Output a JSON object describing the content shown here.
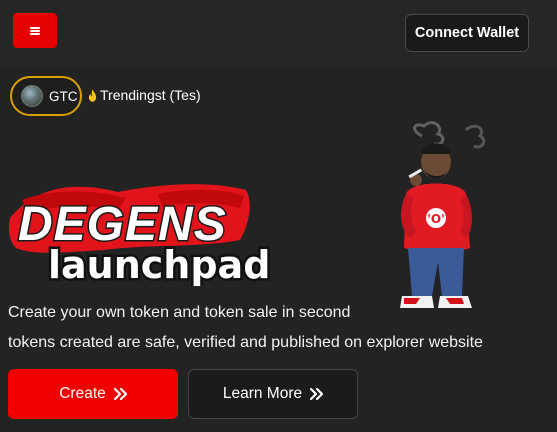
{
  "header": {
    "menu_icon": "hamburger-icon",
    "menu_color": "#e60000",
    "connect_label": "Connect Wallet"
  },
  "trending": {
    "token_symbol": "GTC",
    "token_icon": "token-avatar",
    "label": "Trendingst (Tes)",
    "label_icon": "fire-icon",
    "pill_border_color": "#d9a000"
  },
  "hero": {
    "logo_word1": "DEGENS",
    "logo_word2": "launchpad",
    "line1": "Create your own token and token sale in second",
    "line2": "tokens created are safe, verified and published on explorer website"
  },
  "actions": {
    "create_label": "Create",
    "learn_label": "Learn More",
    "arrow_icon": "double-chevron-right-icon",
    "primary_color": "#f20000"
  }
}
